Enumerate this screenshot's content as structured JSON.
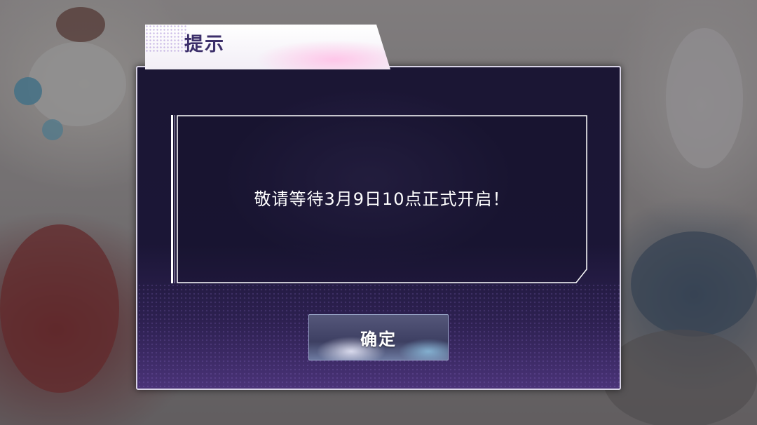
{
  "dialog": {
    "title": "提示",
    "message": "敬请等待3月9日10点正式开启！",
    "confirm_label": "确定"
  },
  "colors": {
    "panel_bg": "#1b1634",
    "panel_bottom": "#4a3378",
    "title_text": "#3c2f6a",
    "message_text": "#ffffff",
    "frame_border": "#ffffff"
  }
}
